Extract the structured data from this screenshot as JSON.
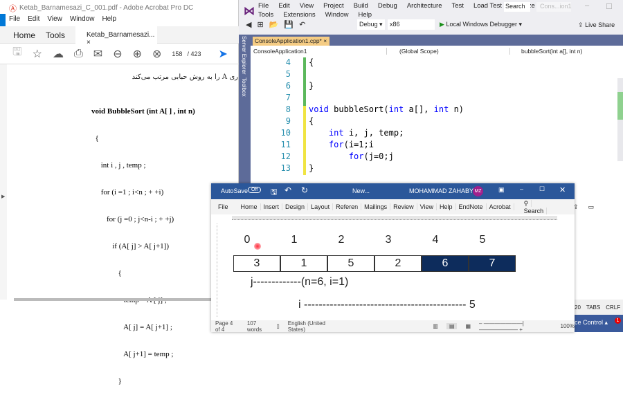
{
  "acrobat": {
    "title": "Ketab_Barnamesazi_C_001.pdf - Adobe Acrobat Pro DC",
    "menu": [
      "File",
      "Edit",
      "View",
      "Window",
      "Help"
    ],
    "tabs": {
      "home": "Home",
      "tools": "Tools",
      "doc": "Ketab_Barnamesazi...",
      "close": "×"
    },
    "page_current": "158",
    "page_total": "/ 423",
    "content": {
      "persian": "ری A را به روش حبابی مرتب می‌کند.",
      "code": [
        "void BubbleSort (int A[ ] , int n)",
        "  {",
        "     int i , j , temp ;",
        "     for (i =1 ; i<n ; + +i)",
        "        for (j =0 ; j<n-i ; + +j)",
        "           if (A[ j] > A[ j+1])",
        "              {",
        "                 temp = A [ j] ;",
        "                 A[ j] = A[ j+1] ;",
        "                 A[ j+1] = temp ;",
        "              }"
      ]
    }
  },
  "vs": {
    "menu_row1": [
      "File",
      "Edit",
      "View",
      "Project",
      "Build",
      "Debug",
      "Architecture",
      "Test",
      "Load Test",
      "Analyze"
    ],
    "menu_row2": [
      "Tools",
      "Extensions",
      "Window",
      "Help"
    ],
    "search": "Search",
    "solution": "Cons...ion1",
    "config": "Debug",
    "platform": "x86",
    "run": "Local Windows Debugger",
    "live_share": "Live Share",
    "side_tabs": [
      "Server Explorer",
      "Toolbox"
    ],
    "file_tab": "ConsoleApplication1.cpp*",
    "nav": {
      "project": "ConsoleApplication1",
      "scope": "(Global Scope)",
      "member": "bubbleSort(int a[], int n)"
    },
    "lines": [
      {
        "n": "4",
        "t": "{"
      },
      {
        "n": "5",
        "t": ""
      },
      {
        "n": "6",
        "t": "}"
      },
      {
        "n": "7",
        "t": ""
      },
      {
        "n": "8",
        "t": "void bubbleSort(int a[], int n)"
      },
      {
        "n": "9",
        "t": "{"
      },
      {
        "n": "10",
        "t": "    int i, j, temp;"
      },
      {
        "n": "11",
        "t": "    for(i=1;i<n;i++)"
      },
      {
        "n": "12",
        "t": "        for(j=0;j<n-i;j++)"
      },
      {
        "n": "13",
        "t": "}"
      }
    ],
    "status": {
      "tabs": "TABS",
      "crlf": "CRLF",
      "col": "20",
      "source_control": "ce Control",
      "notif": "1"
    }
  },
  "word": {
    "autosave": "AutoSave",
    "autosave_state": "Off",
    "doc_title": "New...",
    "user": "MOHAMMAD ZAHABY",
    "initials": "MZ",
    "ribbon": [
      "File",
      "Home",
      "Insert",
      "Design",
      "Layout",
      "Referen",
      "Mailings",
      "Review",
      "View",
      "Help",
      "EndNote",
      "Acrobat"
    ],
    "search": "Search",
    "indices": [
      "0",
      "1",
      "2",
      "3",
      "4",
      "5"
    ],
    "array": [
      {
        "v": "3",
        "hl": false
      },
      {
        "v": "1",
        "hl": false
      },
      {
        "v": "5",
        "hl": false
      },
      {
        "v": "2",
        "hl": false
      },
      {
        "v": "6",
        "hl": true
      },
      {
        "v": "7",
        "hl": true
      }
    ],
    "j_line": "j-------------(n=6, i=1)",
    "i_line": "i -------------------------------------------- 5",
    "status": {
      "page": "Page 4 of 4",
      "words": "107 words",
      "lang": "English (United States)",
      "zoom": "100%"
    },
    "highlight_color": "#0d2c5c",
    "accent": "#2b579a"
  }
}
